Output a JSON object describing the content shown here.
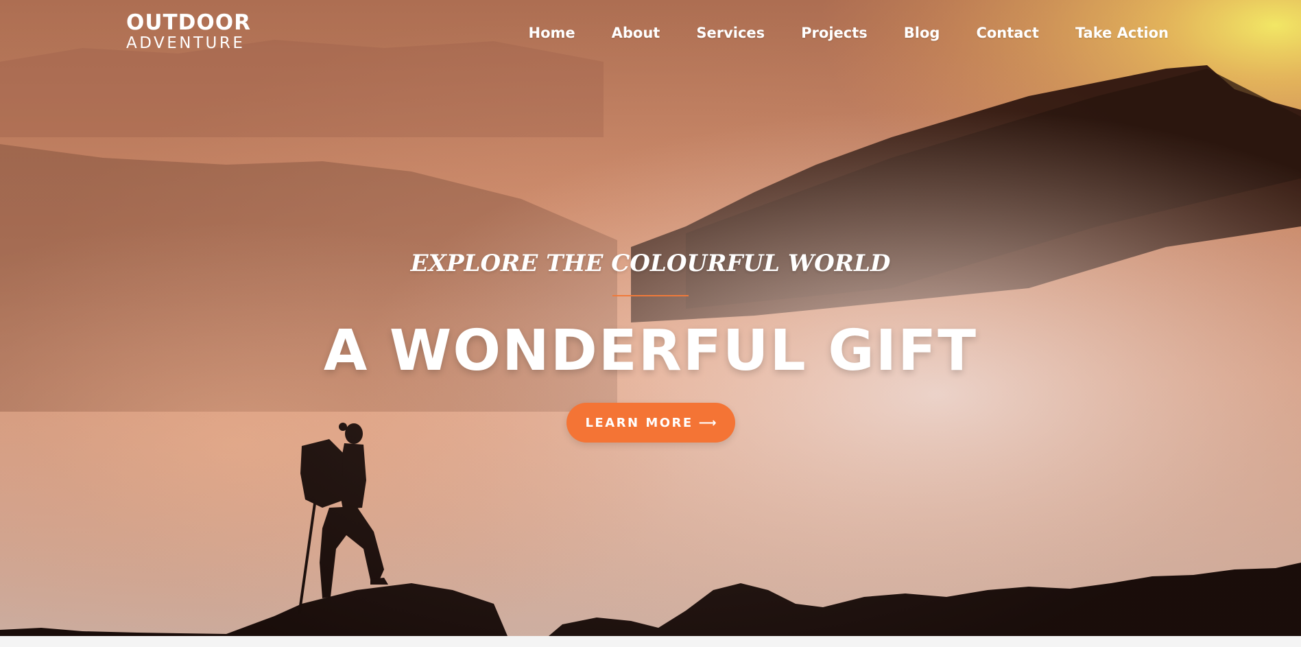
{
  "brand": {
    "name_top": "OUTDOOR",
    "name_bottom": "ADVENTURE"
  },
  "nav": {
    "items": [
      "Home",
      "About",
      "Services",
      "Projects",
      "Blog",
      "Contact",
      "Take Action"
    ]
  },
  "hero": {
    "tagline": "EXPLORE THE COLOURFUL WORLD",
    "headline": "A WONDERFUL GIFT",
    "cta_label": "LEARN MORE",
    "cta_arrow": "⟶"
  },
  "colors": {
    "accent": "#f47435",
    "text": "#ffffff"
  }
}
